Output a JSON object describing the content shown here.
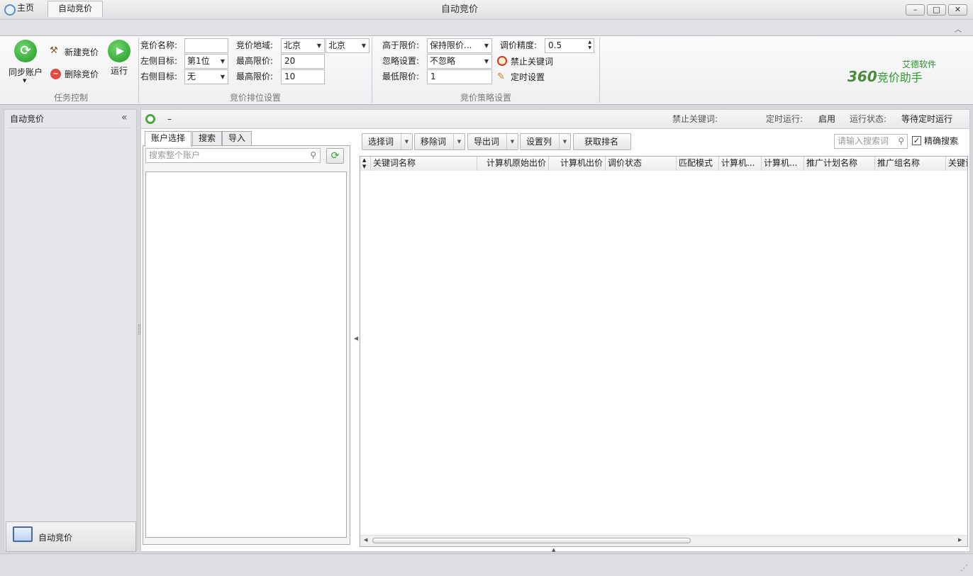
{
  "window": {
    "title": "自动竞价",
    "minimize": "–",
    "maximize": "□",
    "close": "✕"
  },
  "ribbon_tabs": [
    "主页",
    "自动竞价"
  ],
  "task_control": {
    "group_label": "任务控制",
    "sync_accounts": "同步账户",
    "new_bid": "新建竞价",
    "delete_bid": "删除竞价",
    "run": "运行"
  },
  "rank_settings": {
    "group_label": "竞价排位设置",
    "bid_name_label": "竞价名称:",
    "bid_name_value": "",
    "left_target_label": "左侧目标:",
    "left_target_value": "第1位",
    "right_target_label": "右侧目标:",
    "right_target_value": "无",
    "region_label": "竞价地域:",
    "region_value1": "北京",
    "region_value2": "北京",
    "max_price_label1": "最高限价:",
    "max_price_value1": "20",
    "max_price_label2": "最高限价:",
    "max_price_value2": "10"
  },
  "strategy_settings": {
    "group_label": "竞价策略设置",
    "above_limit_label": "高于限价:",
    "above_limit_value": "保持限价...",
    "ignore_label": "忽略设置:",
    "ignore_value": "不忽略",
    "min_price_label": "最低限价:",
    "min_price_value": "1",
    "precision_label": "调价精度:",
    "precision_value": "0.5",
    "ban_keywords": "禁止关键词",
    "timer_settings": "定时设置"
  },
  "brand": {
    "small": "艾德软件",
    "big_num": "360",
    "big_text": "竞价助手"
  },
  "nav": {
    "title": "自动竞价",
    "collapse": "«",
    "bottom_item": "自动竞价"
  },
  "status_line": {
    "dash": "–",
    "ban_keywords_label": "禁止关键词:",
    "timer_label": "定时运行:",
    "timer_value": "启用",
    "run_state_label": "运行状态:",
    "run_state_value": "等待定时运行"
  },
  "left_panel": {
    "tabs": [
      "账户选择",
      "搜索",
      "导入"
    ],
    "search_placeholder": "搜索整个账户"
  },
  "toolbar": {
    "select_words": "选择词",
    "remove_words": "移除词",
    "export_words": "导出词",
    "set_columns": "设置列",
    "get_rank": "获取排名",
    "search_placeholder": "请输入搜索词",
    "exact_search": "精确搜索"
  },
  "table": {
    "columns": [
      "关键词名称",
      "计算机原始出价",
      "计算机出价",
      "调价状态",
      "匹配模式",
      "计算机...",
      "计算机...",
      "推广计划名称",
      "推广组名称",
      "关键词"
    ]
  },
  "colors": {
    "accent_green": "#2fa52f",
    "brand_green": "#3d7a3d",
    "red": "#d9342b"
  }
}
